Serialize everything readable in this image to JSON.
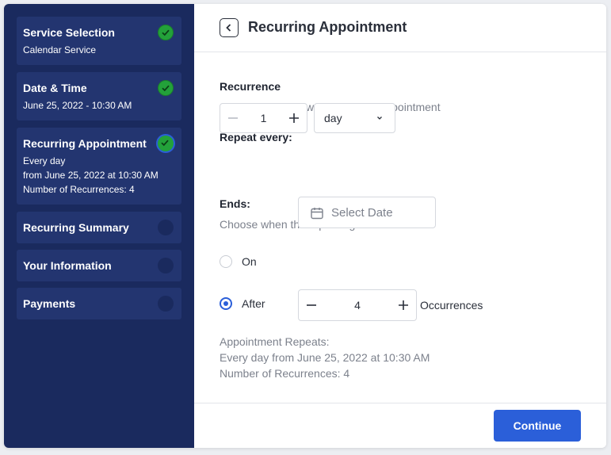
{
  "sidebar": {
    "steps": [
      {
        "title": "Service Selection",
        "lines": [
          "Calendar Service"
        ],
        "status": "done"
      },
      {
        "title": "Date & Time",
        "lines": [
          "June 25, 2022 - 10:30 AM"
        ],
        "status": "done"
      },
      {
        "title": "Recurring Appointment",
        "lines": [
          "Every day",
          "from June 25, 2022 at 10:30 AM",
          "Number of Recurrences: 4"
        ],
        "status": "active"
      },
      {
        "title": "Recurring Summary",
        "lines": [],
        "status": "pending"
      },
      {
        "title": "Your Information",
        "lines": [],
        "status": "pending"
      },
      {
        "title": "Payments",
        "lines": [],
        "status": "pending"
      }
    ]
  },
  "header": {
    "title": "Recurring Appointment"
  },
  "recurrence": {
    "heading": "Recurrence",
    "help": "Choose time you want to repeat appointment",
    "repeat_label": "Repeat every:",
    "repeat_value": "1",
    "unit_value": "day"
  },
  "ends": {
    "heading": "Ends:",
    "help": "Choose when the repeating ends",
    "on_label": "On",
    "date_placeholder": "Select Date",
    "after_label": "After",
    "occurrences_value": "4",
    "occurrences_label": "Occurrences"
  },
  "summary": {
    "line1": "Appointment Repeats:",
    "line2": "Every day from June 25, 2022 at 10:30 AM",
    "line3": "Number of Recurrences: 4"
  },
  "footer": {
    "continue_label": "Continue"
  },
  "colors": {
    "sidebar": "#1a2a5e",
    "step_card": "#233570",
    "accent": "#2b5fd9",
    "check": "#23a13a"
  }
}
